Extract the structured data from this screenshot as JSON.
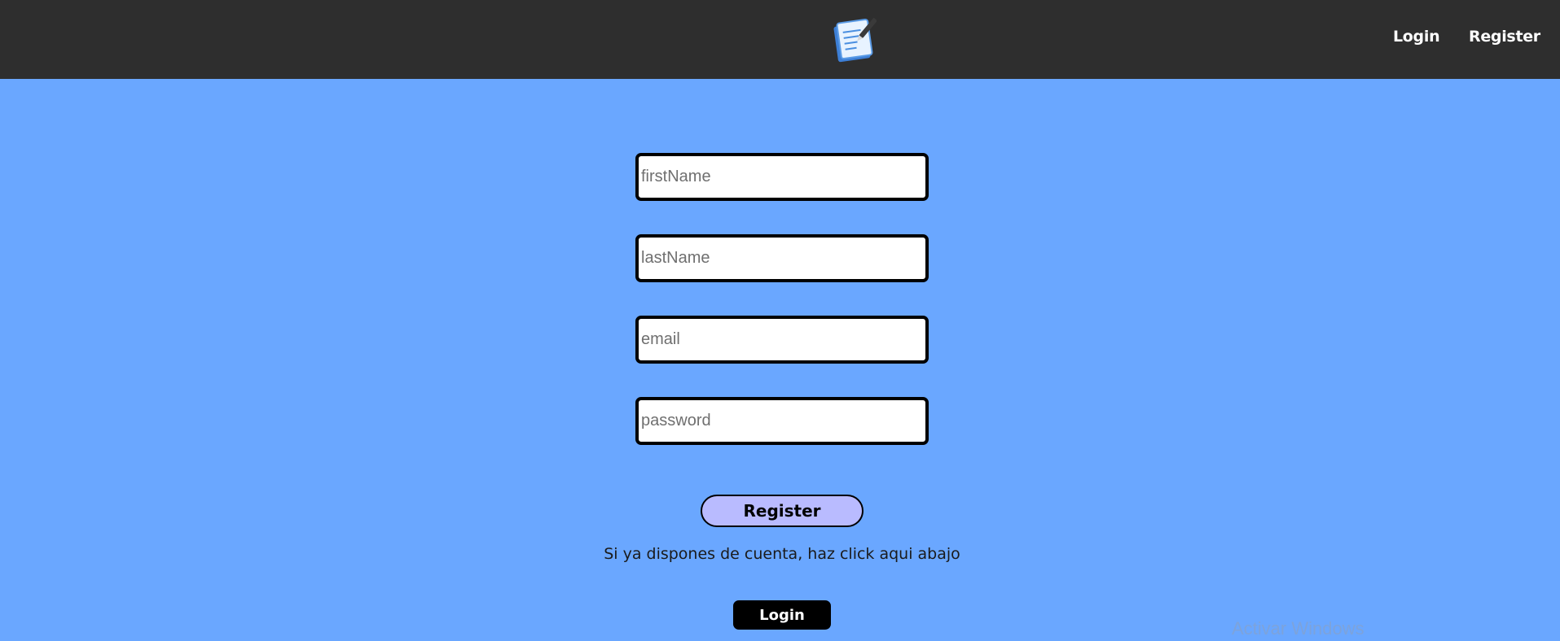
{
  "navbar": {
    "logo_icon": "notepad-pen-icon",
    "links": {
      "login": "Login",
      "register": "Register"
    }
  },
  "form": {
    "fields": {
      "first_name": {
        "placeholder": "firstName",
        "value": ""
      },
      "last_name": {
        "placeholder": "lastName",
        "value": ""
      },
      "email": {
        "placeholder": "email",
        "value": ""
      },
      "password": {
        "placeholder": "password",
        "value": ""
      }
    },
    "register_label": "Register",
    "hint": "Si ya dispones de cuenta, haz click aqui abajo",
    "login_label": "Login"
  },
  "watermark": "Activar Windows",
  "colors": {
    "navbar_bg": "#2e2e2e",
    "page_bg": "#6aa7ff",
    "register_bg": "#b9bbff",
    "login_bg": "#000000"
  }
}
